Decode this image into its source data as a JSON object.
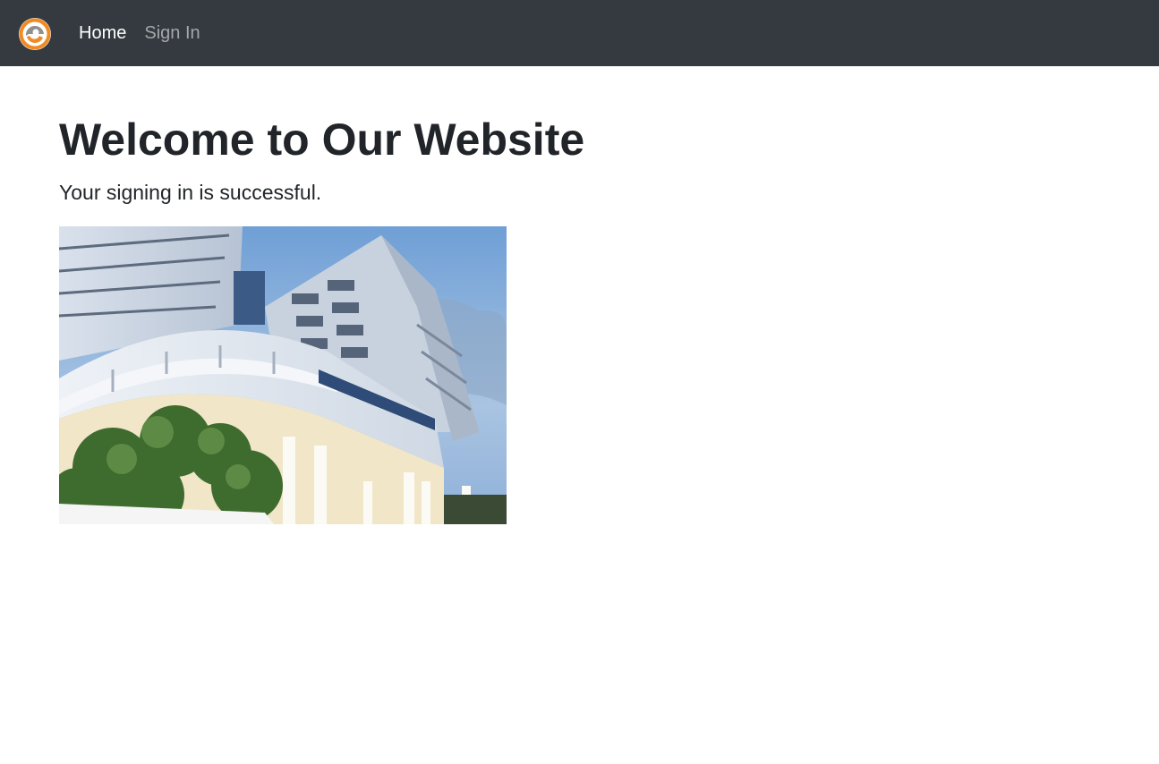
{
  "navbar": {
    "brand_icon": "circular-e-logo-icon",
    "colors": {
      "background": "#343a40",
      "brand_orange": "#f08a24",
      "brand_gray": "#8f8f8f"
    },
    "links": [
      {
        "label": "Home",
        "active": true
      },
      {
        "label": "Sign In",
        "active": false
      }
    ]
  },
  "main": {
    "title": "Welcome to Our Website",
    "lead": "Your signing in is successful.",
    "image_icon": "building-photo"
  }
}
